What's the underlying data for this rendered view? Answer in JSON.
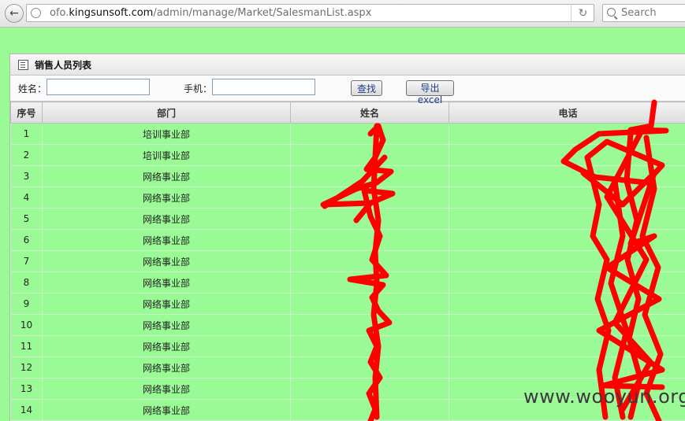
{
  "browser": {
    "url_prefix": "ofo.",
    "url_domain": "kingsunsoft.com",
    "url_path": "/admin/manage/Market/SalesmanList.aspx",
    "search_placeholder": "Search"
  },
  "panel": {
    "title": "销售人员列表",
    "name_label": "姓名：",
    "phone_label": "手机：",
    "name_value": "",
    "phone_value": "",
    "search_button": "查找",
    "export_button": "导出excel"
  },
  "table": {
    "headers": [
      "序号",
      "部门",
      "姓名",
      "电话"
    ],
    "rows": [
      {
        "no": "1",
        "dept": "培训事业部"
      },
      {
        "no": "2",
        "dept": "培训事业部"
      },
      {
        "no": "3",
        "dept": "网络事业部"
      },
      {
        "no": "4",
        "dept": "网络事业部"
      },
      {
        "no": "5",
        "dept": "网络事业部"
      },
      {
        "no": "6",
        "dept": "网络事业部"
      },
      {
        "no": "7",
        "dept": "网络事业部"
      },
      {
        "no": "8",
        "dept": "网络事业部"
      },
      {
        "no": "9",
        "dept": "网络事业部"
      },
      {
        "no": "10",
        "dept": "网络事业部"
      },
      {
        "no": "11",
        "dept": "网络事业部"
      },
      {
        "no": "12",
        "dept": "网络事业部"
      },
      {
        "no": "13",
        "dept": "网络事业部"
      },
      {
        "no": "14",
        "dept": "网络事业部"
      }
    ]
  },
  "redaction_color": "#ff0000",
  "watermark": "www.wooyun.org"
}
